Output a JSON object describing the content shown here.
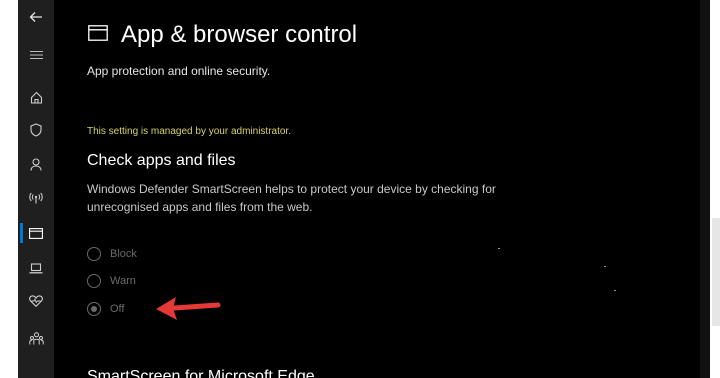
{
  "page": {
    "title": "App & browser control",
    "subtitle": "App protection and online security."
  },
  "admin_note": "This setting is managed by your administrator.",
  "check_apps": {
    "heading": "Check apps and files",
    "description": "Windows Defender SmartScreen helps to protect your device by checking for unrecognised apps and files from the web.",
    "options": [
      {
        "label": "Block",
        "selected": false
      },
      {
        "label": "Warn",
        "selected": false
      },
      {
        "label": "Off",
        "selected": true
      }
    ]
  },
  "next_section": {
    "heading": "SmartScreen for Microsoft Edge"
  },
  "sidebar": {
    "items": [
      {
        "icon": "back-arrow-icon"
      },
      {
        "icon": "hamburger-menu-icon"
      },
      {
        "icon": "home-icon"
      },
      {
        "icon": "shield-icon"
      },
      {
        "icon": "person-icon"
      },
      {
        "icon": "wireless-icon"
      },
      {
        "icon": "app-browser-icon",
        "active": true
      },
      {
        "icon": "laptop-icon"
      },
      {
        "icon": "heart-health-icon"
      },
      {
        "icon": "family-icon"
      }
    ]
  },
  "colors": {
    "background": "#000000",
    "sidebar": "#1f1f1f",
    "accent": "#0078d7",
    "admin_note": "#d8d36a",
    "disabled_option": "#6a6a6a",
    "arrow": "#e53935"
  }
}
